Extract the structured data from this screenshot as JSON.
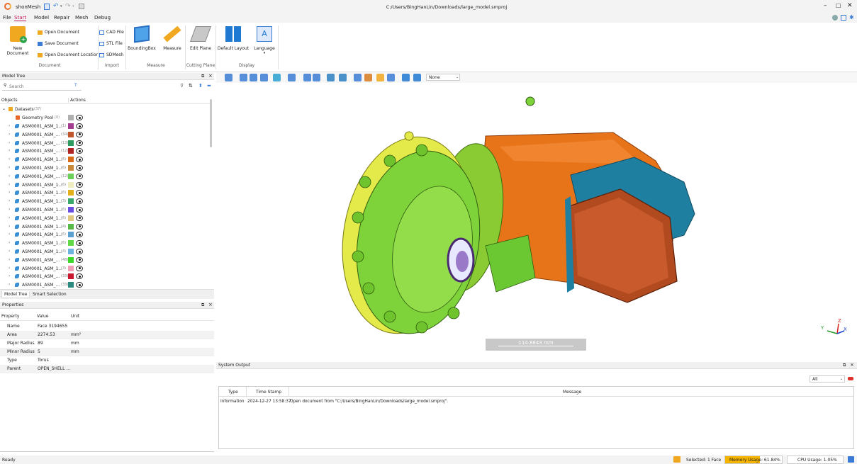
{
  "window": {
    "app_name": "shonMesh",
    "title": "C:/Users/BingHanLin/Downloads/large_model.smproj"
  },
  "menu": [
    "File",
    "Start",
    "Model",
    "Repair",
    "Mesh",
    "Debug"
  ],
  "ribbon": {
    "document": {
      "new": "New Document",
      "open": "Open Document",
      "save": "Save Document",
      "open_loc": "Open Document Location",
      "label": "Document"
    },
    "import": {
      "cad": "CAD File",
      "stl": "STL File",
      "sdmesh": "SDMesh",
      "label": "Import"
    },
    "measure": {
      "bbox": "BoundingBox",
      "measure": "Measure",
      "label": "Measure"
    },
    "cutting": {
      "edit": "Edit Plane",
      "label": "Cutting Plane"
    },
    "display": {
      "layout": "Default Layout",
      "language": "Language",
      "label": "Display"
    }
  },
  "model_tree": {
    "title": "Model Tree",
    "search_placeholder": "Search",
    "col_objects": "Objects",
    "col_actions": "Actions",
    "root": {
      "label": "Datasets",
      "count": "(37)"
    },
    "pool": {
      "label": "Geometry Pool",
      "count": "(0)",
      "color": "#b0b0b0"
    },
    "items": [
      {
        "label": "ASM0001_ASM_1...",
        "count": "(1)",
        "color": "#a23c8e"
      },
      {
        "label": "ASM0001_ASM_...",
        "count": "(34)",
        "color": "#c0562e"
      },
      {
        "label": "ASM0001_ASM_...",
        "count": "(13)",
        "color": "#2e9a5f"
      },
      {
        "label": "ASM0001_ASM_...",
        "count": "(12)",
        "color": "#b02424"
      },
      {
        "label": "ASM0001_ASM_1...",
        "count": "(6)",
        "color": "#d86a18"
      },
      {
        "label": "ASM0001_ASM_1...",
        "count": "(6)",
        "color": "#c88a3a"
      },
      {
        "label": "ASM0001_ASM_...",
        "count": "(12)",
        "color": "#6ccf5c"
      },
      {
        "label": "ASM0001_ASM_1...",
        "count": "(6)",
        "color": "#f0eec0"
      },
      {
        "label": "ASM0001_ASM_1...",
        "count": "(6)",
        "color": "#e2b018"
      },
      {
        "label": "ASM0001_ASM_1...",
        "count": "(3)",
        "color": "#3aa86a"
      },
      {
        "label": "ASM0001_ASM_1...",
        "count": "(6)",
        "color": "#6a4ee0"
      },
      {
        "label": "ASM0001_ASM_1...",
        "count": "(6)",
        "color": "#e0c880"
      },
      {
        "label": "ASM0001_ASM_1...",
        "count": "(4)",
        "color": "#58b848"
      },
      {
        "label": "ASM0001_ASM_1...",
        "count": "(6)",
        "color": "#5aa0d0"
      },
      {
        "label": "ASM0001_ASM_1...",
        "count": "(6)",
        "color": "#60d848"
      },
      {
        "label": "ASM0001_ASM_1...",
        "count": "(4)",
        "color": "#6cb4e0"
      },
      {
        "label": "ASM0001_ASM_...",
        "count": "(48)",
        "color": "#3cd82c"
      },
      {
        "label": "ASM0001_ASM_1...",
        "count": "(3)",
        "color": "#f0a0b8"
      },
      {
        "label": "ASM0001_ASM_...",
        "count": "(33)",
        "color": "#c81830"
      },
      {
        "label": "ASM0001_ASM_...",
        "count": "(33)",
        "color": "#2a8a80"
      }
    ],
    "tabs": [
      "Model Tree",
      "Smart Selection"
    ]
  },
  "properties": {
    "title": "Properties",
    "headers": [
      "Property",
      "Value",
      "Unit"
    ],
    "rows": [
      [
        "Name",
        "Face 3194655",
        ""
      ],
      [
        "Area",
        "2274.53",
        "mm²"
      ],
      [
        "Major Radius",
        "89",
        "mm"
      ],
      [
        "Minor Radius",
        "5",
        "mm"
      ],
      [
        "Type",
        "Torus",
        ""
      ],
      [
        "Parent",
        "OPEN_SHELL ...",
        ""
      ]
    ]
  },
  "viewport": {
    "select_value": "None",
    "scale_label": "114.8843 mm",
    "axis": {
      "x": "X",
      "y": "Y",
      "z": "Z"
    }
  },
  "output": {
    "title": "System Output",
    "filter": "All",
    "headers": [
      "Type",
      "Time Stamp",
      "Message"
    ],
    "rows": [
      [
        "Information",
        "2024-12-27 13:58:37",
        "Open document from \"C:/Users/BingHanLin/Downloads/large_model.smproj\"."
      ]
    ]
  },
  "status": {
    "ready": "Ready",
    "selected": "Selected: 1 Face",
    "memory": "Memory Usage: 61.84%",
    "memory_fraction": 0.6184,
    "cpu": "CPU Usage: 1.05%"
  }
}
